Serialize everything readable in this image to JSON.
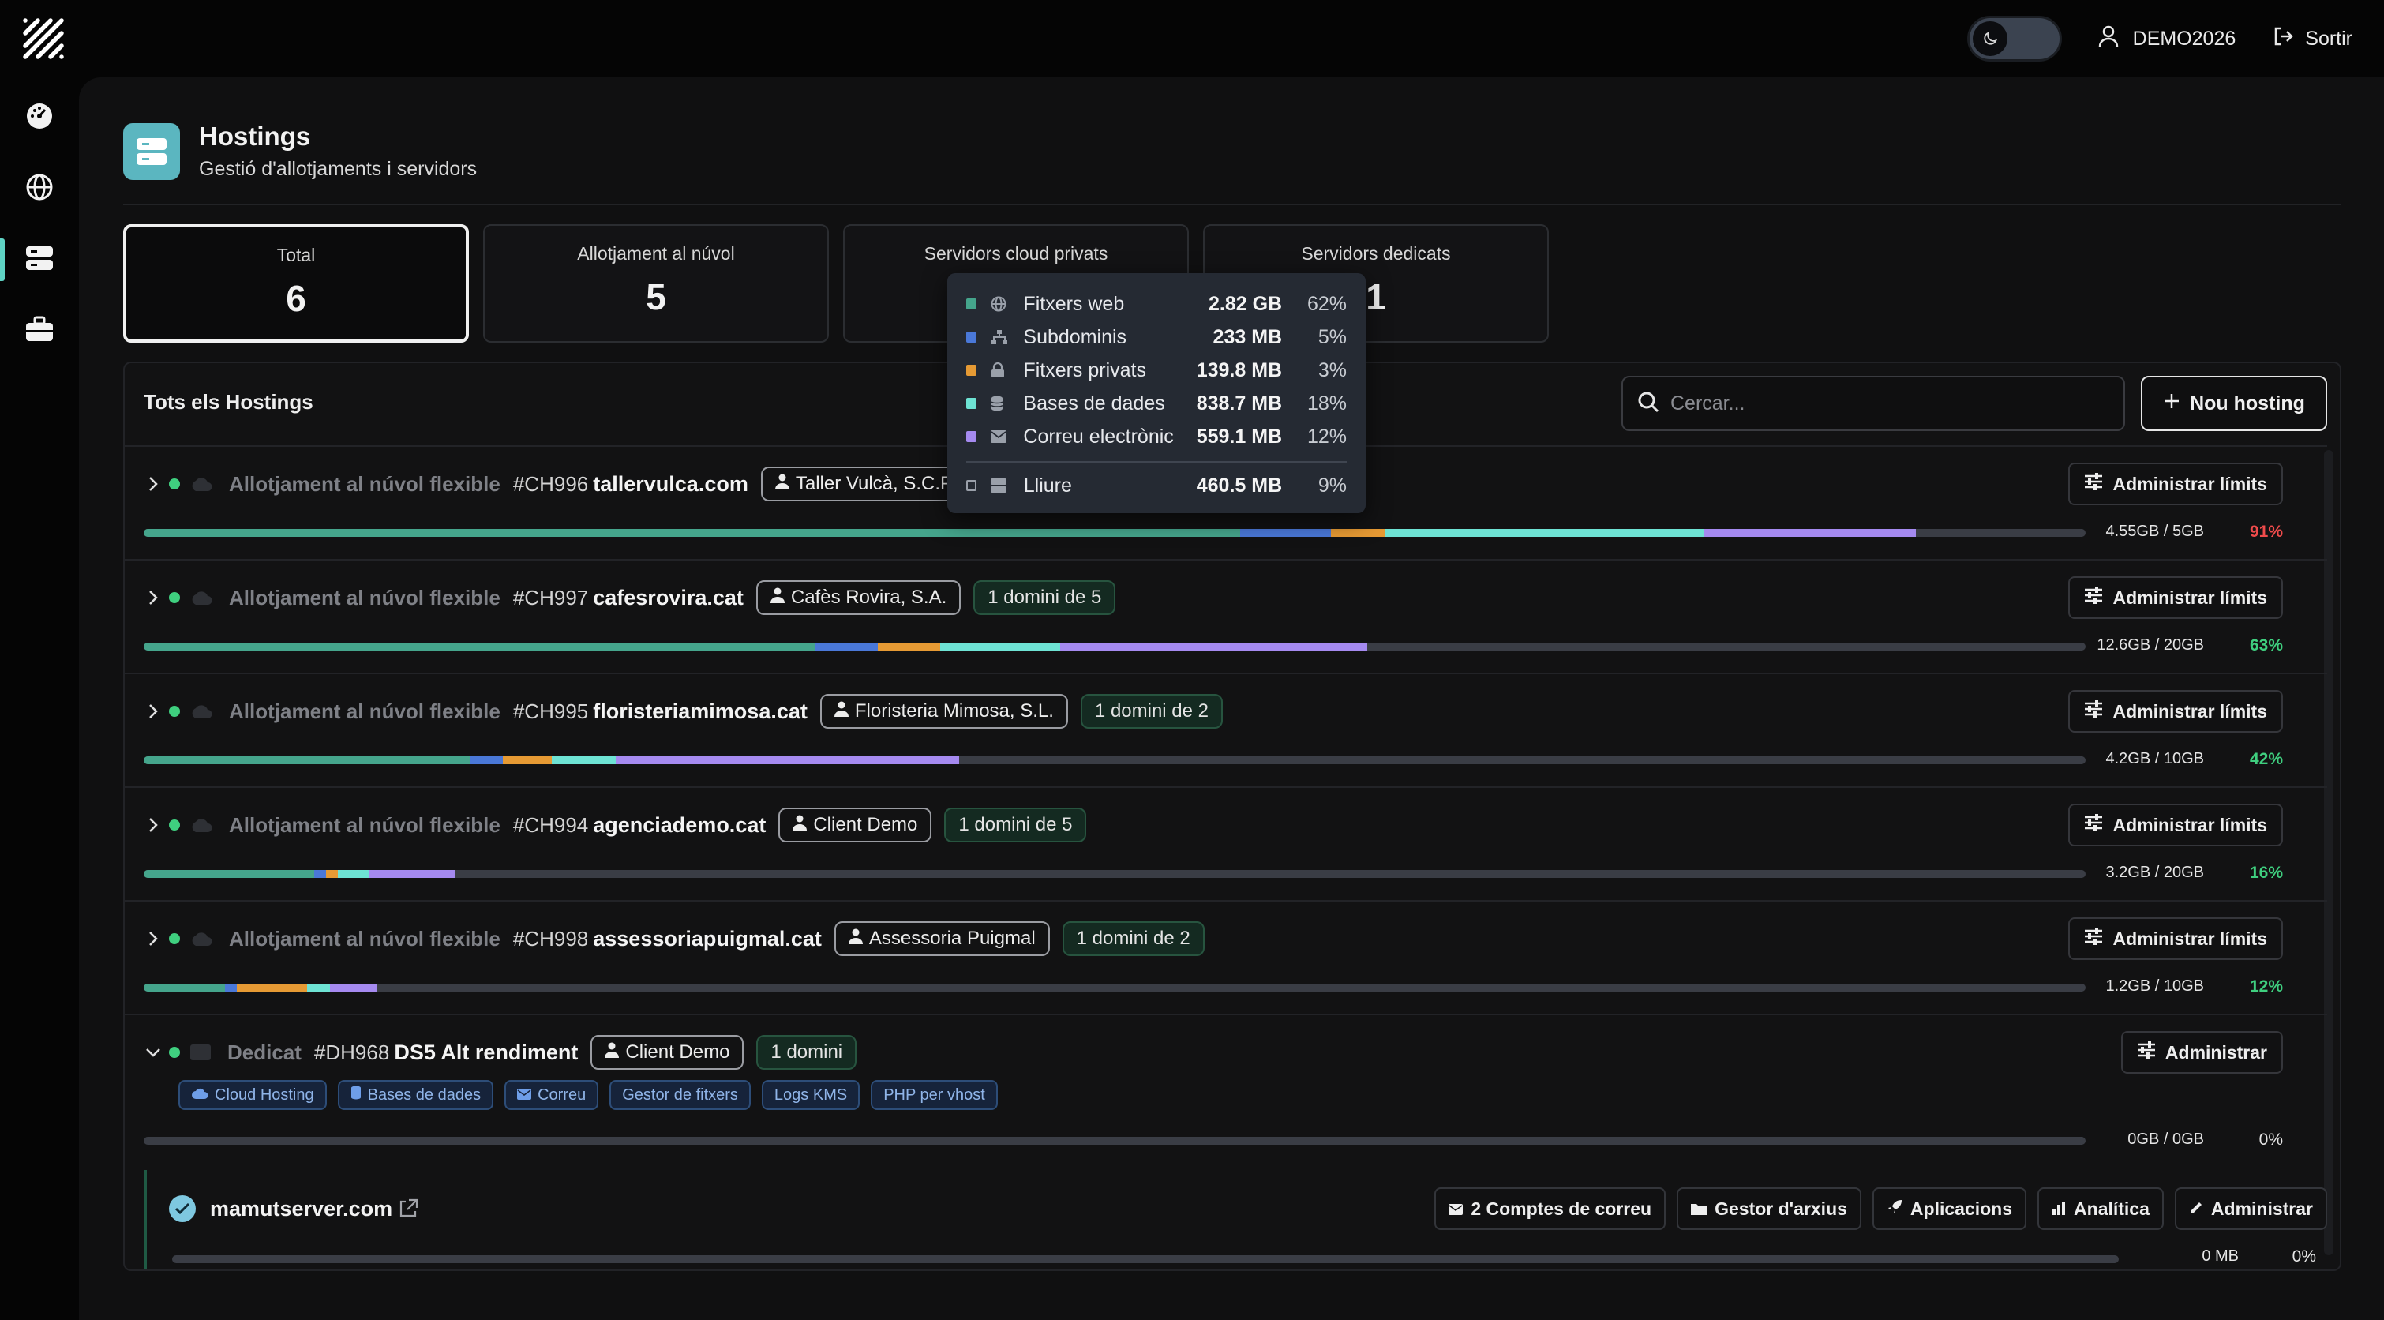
{
  "topbar": {
    "user": "DEMO2026",
    "logout": "Sortir"
  },
  "sidebar": {
    "items": [
      {
        "icon": "dashboard-icon"
      },
      {
        "icon": "globe-icon"
      },
      {
        "icon": "server-icon",
        "active": true
      },
      {
        "icon": "briefcase-icon"
      }
    ]
  },
  "page": {
    "title": "Hostings",
    "subtitle": "Gestió d'allotjaments i servidors"
  },
  "stats": [
    {
      "label": "Total",
      "value": "6"
    },
    {
      "label": "Allotjament al núvol",
      "value": "5"
    },
    {
      "label": "Servidors cloud privats",
      "value": ""
    },
    {
      "label": "Servidors dedicats",
      "value": "1"
    }
  ],
  "panel": {
    "title": "Tots els Hostings",
    "search_placeholder": "Cercar...",
    "new_button": "Nou hosting"
  },
  "rows": [
    {
      "type": "Allotjament al núvol flexible",
      "code": "#CH996",
      "domain": "tallervulca.com",
      "client": "Taller Vulcà, S.C.P.",
      "domains": "",
      "action": "Administrar límits",
      "usage": "4.55GB / 5GB",
      "pct": "91%",
      "pct_color": "#ef4b4b",
      "segments": [
        0.5648,
        0.0467,
        0.028,
        0.1638,
        0.1095
      ]
    },
    {
      "type": "Allotjament al núvol flexible",
      "code": "#CH997",
      "domain": "cafesrovira.cat",
      "client": "Cafès Rovira, S.A.",
      "domains": "1 domini de 5",
      "action": "Administrar límits",
      "usage": "12.6GB / 20GB",
      "pct": "63%",
      "pct_color": "#3fcf7f",
      "segments": [
        0.346,
        0.032,
        0.032,
        0.062,
        0.158
      ]
    },
    {
      "type": "Allotjament al núvol flexible",
      "code": "#CH995",
      "domain": "floristeriamimosa.cat",
      "client": "Floristeria Mimosa, S.L.",
      "domains": "1 domini de 2",
      "action": "Administrar límits",
      "usage": "4.2GB / 10GB",
      "pct": "42%",
      "pct_color": "#3fcf7f",
      "segments": [
        0.168,
        0.017,
        0.025,
        0.033,
        0.177
      ]
    },
    {
      "type": "Allotjament al núvol flexible",
      "code": "#CH994",
      "domain": "agenciademo.cat",
      "client": "Client Demo",
      "domains": "1 domini de 5",
      "action": "Administrar límits",
      "usage": "3.2GB / 20GB",
      "pct": "16%",
      "pct_color": "#3fcf7f",
      "segments": [
        0.088,
        0.006,
        0.006,
        0.016,
        0.044
      ]
    },
    {
      "type": "Allotjament al núvol flexible",
      "code": "#CH998",
      "domain": "assessoriapuigmal.cat",
      "client": "Assessoria Puigmal",
      "domains": "1 domini de 2",
      "action": "Administrar límits",
      "usage": "1.2GB / 10GB",
      "pct": "12%",
      "pct_color": "#3fcf7f",
      "segments": [
        0.042,
        0.006,
        0.036,
        0.012,
        0.024
      ]
    }
  ],
  "dedicated": {
    "type": "Dedicat",
    "code": "#DH968",
    "name": "DS5 Alt rendiment",
    "client": "Client Demo",
    "domains": "1 domini",
    "action": "Administrar",
    "usage": "0GB / 0GB",
    "pct": "0%",
    "features": [
      {
        "label": "Cloud Hosting",
        "icon": "cloud-icon"
      },
      {
        "label": "Bases de dades",
        "icon": "database-icon"
      },
      {
        "label": "Correu",
        "icon": "mail-icon"
      },
      {
        "label": "Gestor de fitxers",
        "icon": ""
      },
      {
        "label": "Logs KMS",
        "icon": ""
      },
      {
        "label": "PHP per vhost",
        "icon": ""
      }
    ],
    "site": {
      "domain": "mamutserver.com",
      "usage": "0 MB",
      "pct": "0%",
      "actions": [
        {
          "label": "2 Comptes de correu",
          "icon": "mail-icon"
        },
        {
          "label": "Gestor d'arxius",
          "icon": "folder-icon"
        },
        {
          "label": "Aplicacions",
          "icon": "rocket-icon"
        },
        {
          "label": "Analítica",
          "icon": "chart-icon"
        },
        {
          "label": "Administrar",
          "icon": "pencil-icon"
        }
      ]
    }
  },
  "colors": {
    "web": "#45a58c",
    "subdomains": "#4a78d8",
    "private": "#e69a34",
    "databases": "#6ee3d4",
    "mail": "#a58af0",
    "free": "#3a3d45"
  },
  "tooltip": {
    "items": [
      {
        "label": "Fitxers web",
        "size": "2.82 GB",
        "pct": "62%",
        "color": "#45a58c",
        "icon": "globe-icon"
      },
      {
        "label": "Subdominis",
        "size": "233 MB",
        "pct": "5%",
        "color": "#4a78d8",
        "icon": "sitemap-icon"
      },
      {
        "label": "Fitxers privats",
        "size": "139.8 MB",
        "pct": "3%",
        "color": "#e69a34",
        "icon": "lock-icon"
      },
      {
        "label": "Bases de dades",
        "size": "838.7 MB",
        "pct": "18%",
        "color": "#6ee3d4",
        "icon": "database-icon"
      },
      {
        "label": "Correu electrònic",
        "size": "559.1 MB",
        "pct": "12%",
        "color": "#a58af0",
        "icon": "mail-icon"
      }
    ],
    "free": {
      "label": "Lliure",
      "size": "460.5 MB",
      "pct": "9%",
      "icon": "server-icon"
    }
  }
}
